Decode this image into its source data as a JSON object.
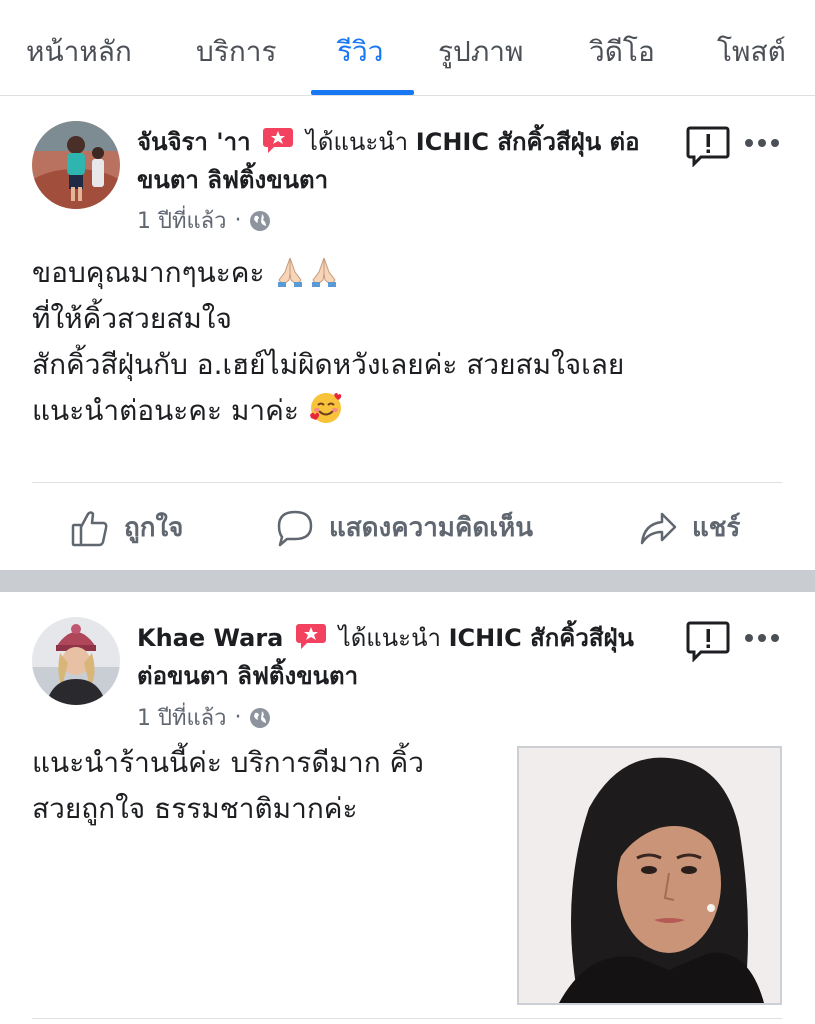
{
  "tabs": [
    {
      "label": "หน้าหลัก",
      "active": false
    },
    {
      "label": "บริการ",
      "active": false
    },
    {
      "label": "รีวิว",
      "active": true
    },
    {
      "label": "รูปภาพ",
      "active": false
    },
    {
      "label": "วิดีโอ",
      "active": false
    },
    {
      "label": "โพสต์",
      "active": false
    }
  ],
  "colors": {
    "accent": "#1877f2",
    "recommend_badge": "#f3425f",
    "secondary_text": "#606770",
    "separator": "#c9ccd1"
  },
  "reviews": [
    {
      "author": "จันจิรา 'าา",
      "recommend_text": "ได้แนะนำ",
      "page_name": "ICHIC สักคิ้วสีฝุ่น ต่อขนตา ลิฟติ้งขนตา",
      "time": "1 ปีที่แล้ว",
      "privacy_icon": "globe-icon",
      "lines": [
        "ขอบคุณมากๆนะคะ",
        "ที่ให้คิ้วสวยสมใจ",
        "สักคิ้วสีฝุ่นกับ อ.เฮย์ไม่ผิดหวังเลยค่ะ สวยสมใจเลย",
        "แนะนำต่อนะคะ มาค่ะ"
      ],
      "emojis": [
        "folded-hands-emoji",
        "folded-hands-emoji",
        "smiling-face-with-hearts-emoji"
      ],
      "actions": {
        "like": "ถูกใจ",
        "comment": "แสดงความคิดเห็น",
        "share": "แชร์"
      }
    },
    {
      "author": "Khae Wara",
      "recommend_text": "ได้แนะนำ",
      "page_name": "ICHIC สักคิ้วสีฝุ่น ต่อขนตา ลิฟติ้งขนตา",
      "time": "1 ปีที่แล้ว",
      "privacy_icon": "globe-icon",
      "lines": [
        "แนะนำร้านนี้ค่ะ บริการดีมาก คิ้ว",
        "สวยถูกใจ ธรรมชาติมากค่ะ"
      ],
      "photo_icon": "review-photo"
    }
  ]
}
